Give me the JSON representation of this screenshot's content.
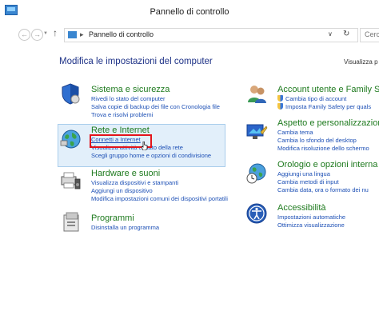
{
  "window": {
    "title": "Pannello di controllo"
  },
  "nav": {
    "back_glyph": "←",
    "forward_glyph": "→",
    "up_glyph": "↑",
    "dropdown_glyph": "▼"
  },
  "address": {
    "separator": "▸",
    "path": "Pannello di controllo",
    "chevron": "∨",
    "refresh": "↻"
  },
  "search": {
    "placeholder": "Cerc"
  },
  "main": {
    "heading": "Modifica le impostazioni del computer",
    "view_by": "Visualizza p"
  },
  "categories": {
    "system": {
      "title": "Sistema e sicurezza",
      "links": [
        "Rivedi lo stato del computer",
        "Salva copie di backup dei file con Cronologia file",
        "Trova e risolvi problemi"
      ]
    },
    "network": {
      "title": "Rete e Internet",
      "links": [
        "Connetti a Internet",
        "Visualizza attività e stato della rete",
        "Scegli gruppo home e opzioni di condivisione"
      ]
    },
    "hardware": {
      "title": "Hardware e suoni",
      "links": [
        "Visualizza dispositivi e stampanti",
        "Aggiungi un dispositivo",
        "Modifica impostazioni comuni dei dispositivi portatili"
      ]
    },
    "programs": {
      "title": "Programmi",
      "links": [
        "Disinstalla un programma"
      ]
    },
    "accounts": {
      "title": "Account utente e Family Sa",
      "links": [
        "Cambia tipo di account",
        "Imposta Family Safety per quals"
      ]
    },
    "appearance": {
      "title": "Aspetto e personalizzazion",
      "links": [
        "Cambia tema",
        "Cambia lo sfondo del desktop",
        "Modifica risoluzione dello schermo"
      ]
    },
    "clock": {
      "title": "Orologio e opzioni interna",
      "links": [
        "Aggiungi una lingua",
        "Cambia metodi di input",
        "Cambia data, ora o formato dei nu"
      ]
    },
    "access": {
      "title": "Accessibilità",
      "links": [
        "Impostazioni automatiche",
        "Ottimizza visualizzazione"
      ]
    }
  }
}
